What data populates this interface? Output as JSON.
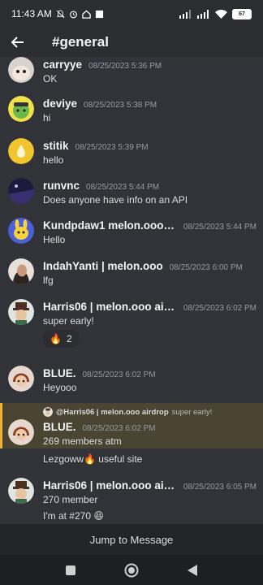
{
  "status_bar": {
    "time": "11:43 AM",
    "battery": "67",
    "icons": [
      "mute-icon",
      "alarm-icon",
      "home-icon",
      "square-icon",
      "signal-icon",
      "wifi-icon",
      "battery-icon"
    ]
  },
  "header": {
    "title": "#general",
    "back_icon": "arrow-left-icon"
  },
  "messages": [
    {
      "author": "carryye",
      "timestamp": "08/25/2023 5:36 PM",
      "text": "OK"
    },
    {
      "author": "deviye",
      "timestamp": "08/25/2023 5:38 PM",
      "text": "hi"
    },
    {
      "author": "stitik",
      "timestamp": "08/25/2023 5:39 PM",
      "text": "hello"
    },
    {
      "author": "runvnc",
      "timestamp": "08/25/2023 5:44 PM",
      "text": "Does anyone have info on an API"
    },
    {
      "author": "Kundpdaw1 melon.oooo ai...",
      "timestamp": "08/25/2023 5:44 PM",
      "text": "Hello"
    },
    {
      "author": "IndahYanti | melon.ooo",
      "timestamp": "08/25/2023 6:00 PM",
      "text": "lfg"
    },
    {
      "author": "Harris06 | melon.ooo airdr...",
      "timestamp": "08/25/2023 6:02 PM",
      "text": "super early!",
      "reaction": {
        "emoji": "🔥",
        "count": "2"
      }
    },
    {
      "author": "BLUE.",
      "timestamp": "08/25/2023 6:02 PM",
      "text": "Heyooo"
    },
    {
      "author": "BLUE.",
      "timestamp": "08/25/2023 6:02 PM",
      "text": "269 members atm",
      "reply": {
        "author": "@Harris06 | melon.ooo airdrop",
        "text": "super early!"
      },
      "followup": "Lezgoww🔥 useful site"
    },
    {
      "author": "Harris06 | melon.ooo airdr...",
      "timestamp": "08/25/2023 6:05 PM",
      "text": "270 member",
      "followup": "I'm at #270 😆"
    }
  ],
  "jump_label": "Jump to Message",
  "colors": {
    "background": "#313338",
    "highlight": "#4a4532",
    "highlight_border": "#f0b232"
  }
}
